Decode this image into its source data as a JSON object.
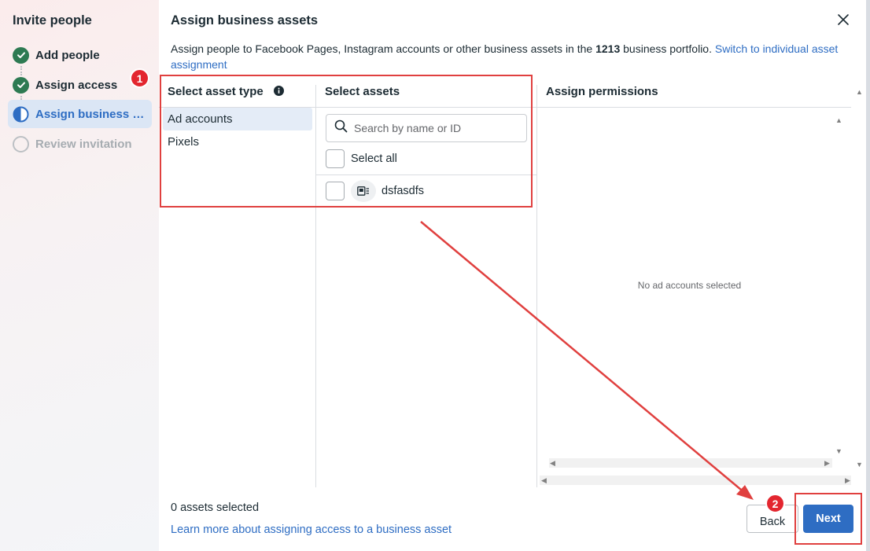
{
  "sidebar": {
    "title": "Invite people",
    "steps": [
      {
        "label": "Add people",
        "state": "done"
      },
      {
        "label": "Assign access",
        "state": "done"
      },
      {
        "label": "Assign business assets",
        "state": "active"
      },
      {
        "label": "Review invitation",
        "state": "pending"
      }
    ]
  },
  "dialog": {
    "title": "Assign business assets",
    "description_prefix": "Assign people to Facebook Pages, Instagram accounts or other business assets in the ",
    "portfolio": "1213",
    "description_suffix": " business portfolio. ",
    "switch_link": "Switch to individual asset assignment",
    "columns": {
      "asset_type": "Select asset type",
      "assets": "Select assets",
      "permissions": "Assign permissions"
    },
    "asset_types": [
      "Ad accounts",
      "Pixels"
    ],
    "search_placeholder": "Search by name or ID",
    "select_all": "Select all",
    "assets": [
      {
        "name": "dsfasdfs"
      }
    ],
    "permissions_empty": "No ad accounts selected",
    "footer": {
      "count": "0 assets selected",
      "learn_more": "Learn more about assigning access to a business asset",
      "back": "Back",
      "next": "Next"
    }
  },
  "annotations": {
    "badge_1": "1",
    "badge_2": "2",
    "color": "#e0403f"
  },
  "colors": {
    "accent": "#2e6dc3",
    "done": "#2d7a52",
    "annotation": "#e0403f"
  }
}
